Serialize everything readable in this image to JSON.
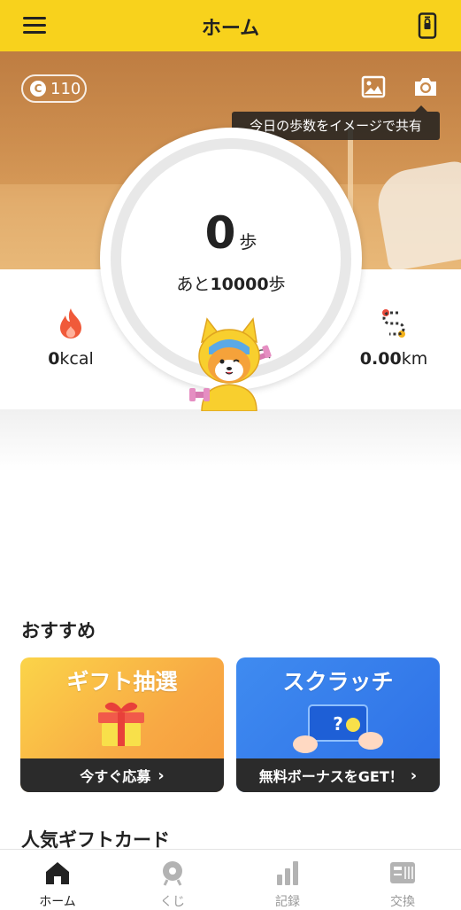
{
  "header": {
    "title": "ホーム"
  },
  "hero": {
    "coins": "110",
    "coin_symbol": "C",
    "tooltip": "今日の歩数をイメージで共有"
  },
  "steps": {
    "count": "0",
    "unit": "歩",
    "remaining_prefix": "あと",
    "remaining_value": "10000",
    "remaining_suffix": "歩",
    "goal_progress": 0
  },
  "stats": {
    "kcal_value": "0",
    "kcal_unit": "kcal",
    "km_value": "0.00",
    "km_unit": "km"
  },
  "recommend": {
    "title": "おすすめ",
    "gift_title": "ギフト抽選",
    "gift_cta": "今すぐ応募",
    "scratch_title": "スクラッチ",
    "scratch_cta": "無料ボーナスをGET！",
    "chevron": "›"
  },
  "popular": {
    "title": "人気ギフトカード"
  },
  "nav": [
    {
      "label": "ホーム",
      "icon": "home-icon",
      "active": true
    },
    {
      "label": "くじ",
      "icon": "lottery-icon",
      "active": false
    },
    {
      "label": "記録",
      "icon": "bar-chart-icon",
      "active": false
    },
    {
      "label": "交換",
      "icon": "exchange-icon",
      "active": false
    }
  ],
  "colors": {
    "brand_yellow": "#f8d21c",
    "ring": "#e8e8e8",
    "flame": "#f05a3a",
    "nav_active": "#222222"
  }
}
